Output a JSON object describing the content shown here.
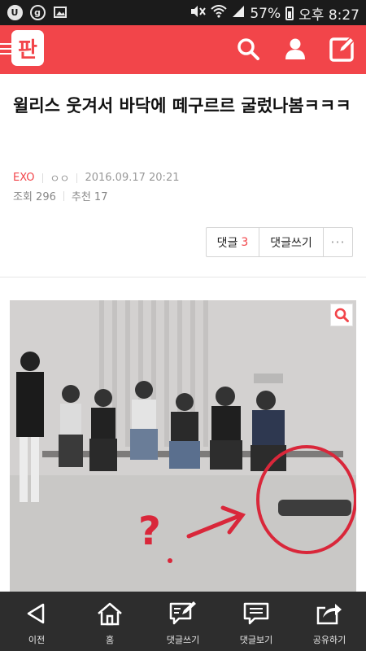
{
  "status_bar": {
    "battery": "57%",
    "time": "오후 8:27"
  },
  "header": {
    "logo_text": "판",
    "accent": "#f2454a"
  },
  "article": {
    "title": "윌리스 웃겨서 바닥에 떼구르르 굴렀나봄ㅋㅋㅋ",
    "category": "EXO",
    "author": "ㅇㅇ",
    "date": "2016.09.17 20:21",
    "views_label": "조회 296",
    "likes_label": "추천 17"
  },
  "actions": {
    "comments_label": "댓글",
    "comments_count": "3",
    "write_label": "댓글쓰기",
    "more_label": "···"
  },
  "image": {
    "description_icons": [
      "zoom-icon"
    ],
    "annotation_mark": "?"
  },
  "bottom_nav": {
    "items": [
      {
        "label": "이전",
        "icon": "back-icon"
      },
      {
        "label": "홈",
        "icon": "home-icon"
      },
      {
        "label": "댓글쓰기",
        "icon": "write-comment-icon"
      },
      {
        "label": "댓글보기",
        "icon": "view-comments-icon"
      },
      {
        "label": "공유하기",
        "icon": "share-icon"
      }
    ]
  }
}
